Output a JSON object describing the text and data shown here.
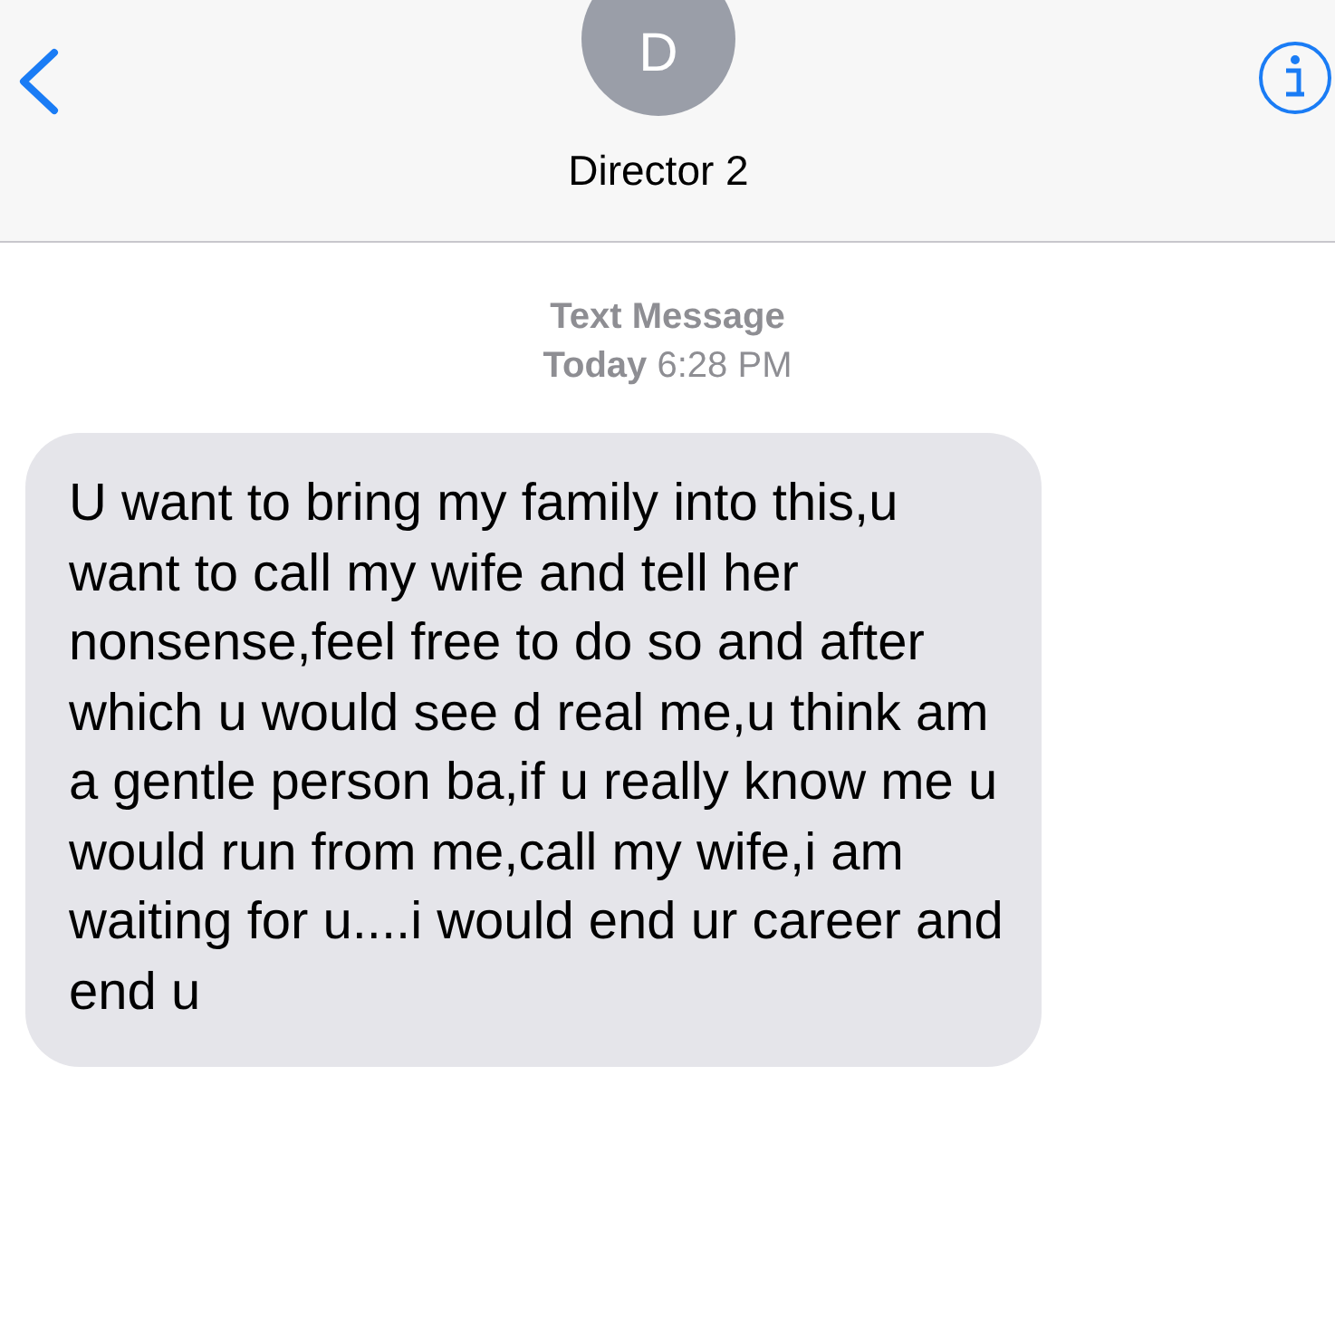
{
  "header": {
    "avatar_initial": "D",
    "contact_name": "Director 2"
  },
  "thread": {
    "service_label": "Text Message",
    "timestamp": "**Today** 6:28 PM",
    "messages": [
      {
        "kind": "incoming",
        "text": "U want to bring my family into this,u want to call my wife and tell her nonsense,feel free to do so and after which u would see d real me,u think am a gentle person ba,if u really know me u would run from me,call my wife,i am waiting for u....i would end ur career and end u"
      }
    ]
  }
}
